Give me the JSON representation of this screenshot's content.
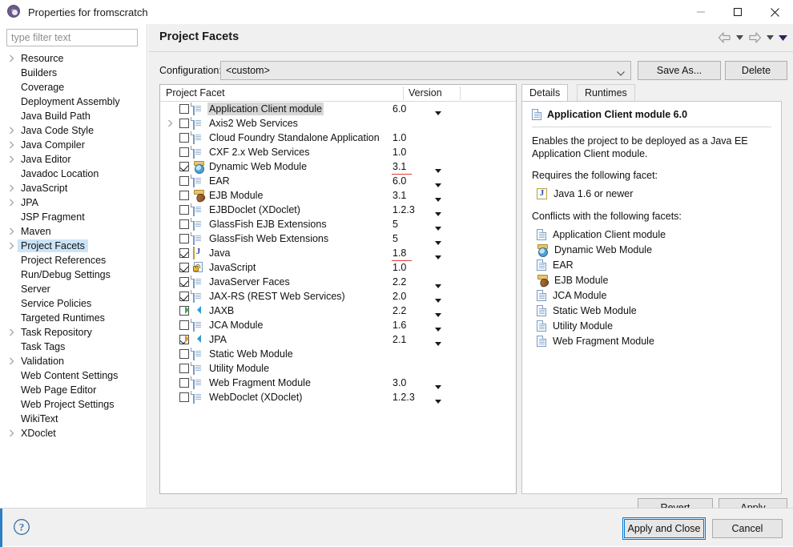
{
  "window": {
    "title": "Properties for fromscratch",
    "icon": "properties-gear-icon",
    "minimize_label": "Minimize",
    "maximize_label": "Maximize",
    "close_label": "Close"
  },
  "sidebar": {
    "filter": {
      "value": "",
      "placeholder": "type filter text"
    },
    "items": [
      {
        "label": "Resource",
        "expandable": true,
        "selected": false
      },
      {
        "label": "Builders",
        "expandable": false,
        "selected": false
      },
      {
        "label": "Coverage",
        "expandable": false,
        "selected": false
      },
      {
        "label": "Deployment Assembly",
        "expandable": false,
        "selected": false
      },
      {
        "label": "Java Build Path",
        "expandable": false,
        "selected": false
      },
      {
        "label": "Java Code Style",
        "expandable": true,
        "selected": false
      },
      {
        "label": "Java Compiler",
        "expandable": true,
        "selected": false
      },
      {
        "label": "Java Editor",
        "expandable": true,
        "selected": false
      },
      {
        "label": "Javadoc Location",
        "expandable": false,
        "selected": false
      },
      {
        "label": "JavaScript",
        "expandable": true,
        "selected": false
      },
      {
        "label": "JPA",
        "expandable": true,
        "selected": false
      },
      {
        "label": "JSP Fragment",
        "expandable": false,
        "selected": false
      },
      {
        "label": "Maven",
        "expandable": true,
        "selected": false
      },
      {
        "label": "Project Facets",
        "expandable": true,
        "selected": true
      },
      {
        "label": "Project References",
        "expandable": false,
        "selected": false
      },
      {
        "label": "Run/Debug Settings",
        "expandable": false,
        "selected": false
      },
      {
        "label": "Server",
        "expandable": false,
        "selected": false
      },
      {
        "label": "Service Policies",
        "expandable": false,
        "selected": false
      },
      {
        "label": "Targeted Runtimes",
        "expandable": false,
        "selected": false
      },
      {
        "label": "Task Repository",
        "expandable": true,
        "selected": false
      },
      {
        "label": "Task Tags",
        "expandable": false,
        "selected": false
      },
      {
        "label": "Validation",
        "expandable": true,
        "selected": false
      },
      {
        "label": "Web Content Settings",
        "expandable": false,
        "selected": false
      },
      {
        "label": "Web Page Editor",
        "expandable": false,
        "selected": false
      },
      {
        "label": "Web Project Settings",
        "expandable": false,
        "selected": false
      },
      {
        "label": "WikiText",
        "expandable": false,
        "selected": false
      },
      {
        "label": "XDoclet",
        "expandable": true,
        "selected": false
      }
    ]
  },
  "page": {
    "title": "Project Facets",
    "nav": {
      "back_label": "Back",
      "back_menu_label": "Back history",
      "forward_label": "Forward",
      "forward_menu_label": "Forward history",
      "menu_label": "View menu"
    }
  },
  "configuration": {
    "label": "Configuration:",
    "value": "<custom>",
    "save_as_label": "Save As...",
    "delete_label": "Delete"
  },
  "facets_table": {
    "columns": [
      "Project Facet",
      "Version"
    ],
    "rows": [
      {
        "name": "Application Client module",
        "version": "6.0",
        "checked": false,
        "icon": "doc",
        "dropdown": true,
        "expandable": false,
        "selected": true,
        "underlined": false
      },
      {
        "name": "Axis2 Web Services",
        "version": "",
        "checked": false,
        "icon": "doc",
        "dropdown": false,
        "expandable": true,
        "selected": false,
        "underlined": false
      },
      {
        "name": "Cloud Foundry Standalone Application",
        "version": "1.0",
        "checked": false,
        "icon": "doc",
        "dropdown": false,
        "expandable": false,
        "selected": false,
        "underlined": false
      },
      {
        "name": "CXF 2.x Web Services",
        "version": "1.0",
        "checked": false,
        "icon": "doc",
        "dropdown": false,
        "expandable": false,
        "selected": false,
        "underlined": false
      },
      {
        "name": "Dynamic Web Module",
        "version": "3.1",
        "checked": true,
        "icon": "web",
        "dropdown": true,
        "expandable": false,
        "selected": false,
        "underlined": true
      },
      {
        "name": "EAR",
        "version": "6.0",
        "checked": false,
        "icon": "doc",
        "dropdown": true,
        "expandable": false,
        "selected": false,
        "underlined": false
      },
      {
        "name": "EJB Module",
        "version": "3.1",
        "checked": false,
        "icon": "ejb",
        "dropdown": true,
        "expandable": false,
        "selected": false,
        "underlined": false
      },
      {
        "name": "EJBDoclet (XDoclet)",
        "version": "1.2.3",
        "checked": false,
        "icon": "doc",
        "dropdown": true,
        "expandable": false,
        "selected": false,
        "underlined": false
      },
      {
        "name": "GlassFish EJB Extensions",
        "version": "5",
        "checked": false,
        "icon": "doc",
        "dropdown": true,
        "expandable": false,
        "selected": false,
        "underlined": false
      },
      {
        "name": "GlassFish Web Extensions",
        "version": "5",
        "checked": false,
        "icon": "doc",
        "dropdown": true,
        "expandable": false,
        "selected": false,
        "underlined": false
      },
      {
        "name": "Java",
        "version": "1.8",
        "checked": true,
        "icon": "java",
        "dropdown": true,
        "expandable": false,
        "selected": false,
        "underlined": true
      },
      {
        "name": "JavaScript",
        "version": "1.0",
        "checked": true,
        "icon": "js",
        "dropdown": false,
        "expandable": false,
        "selected": false,
        "underlined": false
      },
      {
        "name": "JavaServer Faces",
        "version": "2.2",
        "checked": true,
        "icon": "doc",
        "dropdown": true,
        "expandable": false,
        "selected": false,
        "underlined": false
      },
      {
        "name": "JAX-RS (REST Web Services)",
        "version": "2.0",
        "checked": true,
        "icon": "doc",
        "dropdown": true,
        "expandable": false,
        "selected": false,
        "underlined": false
      },
      {
        "name": "JAXB",
        "version": "2.2",
        "checked": false,
        "icon": "jaxb",
        "dropdown": true,
        "expandable": false,
        "selected": false,
        "underlined": false
      },
      {
        "name": "JCA Module",
        "version": "1.6",
        "checked": false,
        "icon": "doc",
        "dropdown": true,
        "expandable": false,
        "selected": false,
        "underlined": false
      },
      {
        "name": "JPA",
        "version": "2.1",
        "checked": true,
        "icon": "jpa",
        "dropdown": true,
        "expandable": false,
        "selected": false,
        "underlined": false
      },
      {
        "name": "Static Web Module",
        "version": "",
        "checked": false,
        "icon": "doc",
        "dropdown": false,
        "expandable": false,
        "selected": false,
        "underlined": false
      },
      {
        "name": "Utility Module",
        "version": "",
        "checked": false,
        "icon": "doc",
        "dropdown": false,
        "expandable": false,
        "selected": false,
        "underlined": false
      },
      {
        "name": "Web Fragment Module",
        "version": "3.0",
        "checked": false,
        "icon": "doc",
        "dropdown": true,
        "expandable": false,
        "selected": false,
        "underlined": false
      },
      {
        "name": "WebDoclet (XDoclet)",
        "version": "1.2.3",
        "checked": false,
        "icon": "doc",
        "dropdown": true,
        "expandable": false,
        "selected": false,
        "underlined": false
      }
    ]
  },
  "details": {
    "tabs": [
      {
        "label": "Details",
        "active": true
      },
      {
        "label": "Runtimes",
        "active": false
      }
    ],
    "heading": "Application Client module 6.0",
    "heading_icon": "doc",
    "description": "Enables the project to be deployed as a Java EE Application Client module.",
    "requires_label": "Requires the following facet:",
    "requires": [
      {
        "label": "Java 1.6 or newer",
        "icon": "java"
      }
    ],
    "conflicts_label": "Conflicts with the following facets:",
    "conflicts": [
      {
        "label": "Application Client module",
        "icon": "doc"
      },
      {
        "label": "Dynamic Web Module",
        "icon": "web"
      },
      {
        "label": "EAR",
        "icon": "doc"
      },
      {
        "label": "EJB Module",
        "icon": "ejb"
      },
      {
        "label": "JCA Module",
        "icon": "doc"
      },
      {
        "label": "Static Web Module",
        "icon": "doc"
      },
      {
        "label": "Utility Module",
        "icon": "doc"
      },
      {
        "label": "Web Fragment Module",
        "icon": "doc"
      }
    ]
  },
  "buttons": {
    "revert": "Revert",
    "apply": "Apply",
    "apply_and_close": "Apply and Close",
    "cancel": "Cancel",
    "help_label": "Help"
  },
  "colors": {
    "accent": "#0078d7",
    "selection": "#cce4f7",
    "row_selection": "#d6d6d6",
    "warning_underline": "#e53935",
    "footer_accent": "#2b7fc4"
  }
}
